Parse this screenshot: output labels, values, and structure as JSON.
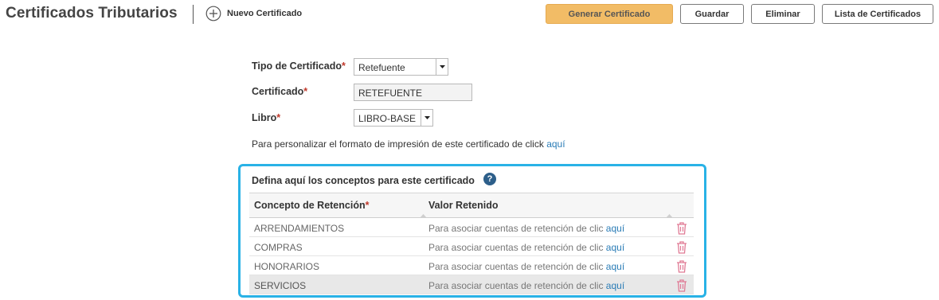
{
  "header": {
    "title": "Certificados Tributarios",
    "new_label": "Nuevo Certificado",
    "buttons": {
      "generate": "Generar Certificado",
      "save": "Guardar",
      "delete": "Eliminar",
      "list": "Lista de Certificados"
    }
  },
  "form": {
    "tipo": {
      "label": "Tipo de Certificado",
      "value": "Retefuente"
    },
    "certificado": {
      "label": "Certificado",
      "value": "RETEFUENTE"
    },
    "libro": {
      "label": "Libro",
      "value": "LIBRO-BASE"
    },
    "required_mark": "*",
    "note_text": "Para personalizar el formato de impresión de este certificado de click ",
    "note_link": "aquí"
  },
  "concepts": {
    "title": "Defina aquí los conceptos para este certificado",
    "help_glyph": "?",
    "headers": {
      "concept": "Concepto de Retención",
      "value": "Valor Retenido"
    },
    "value_text": "Para asociar cuentas de retención de clic ",
    "value_link": "aquí",
    "rows": [
      {
        "name": "ARRENDAMIENTOS"
      },
      {
        "name": "COMPRAS"
      },
      {
        "name": "HONORARIOS"
      },
      {
        "name": "SERVICIOS"
      }
    ]
  },
  "colors": {
    "accent_button": "#f2bc66",
    "panel_border": "#29b2e6",
    "link": "#2a7cb6",
    "required": "#c0392b",
    "trash": "#e07a95"
  }
}
